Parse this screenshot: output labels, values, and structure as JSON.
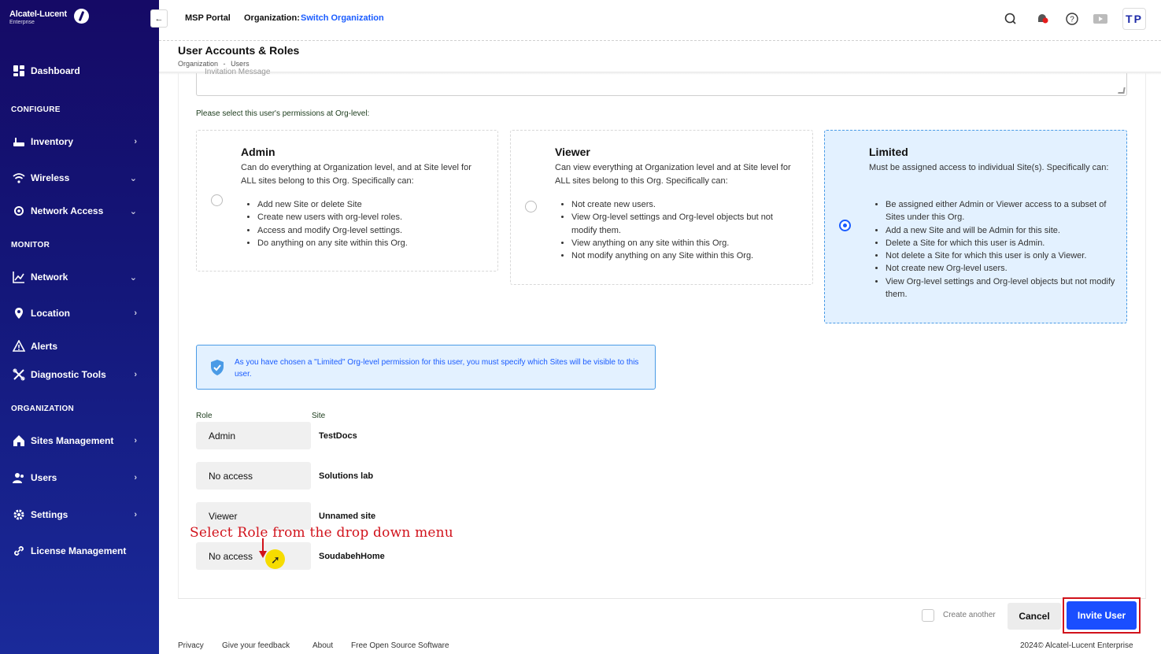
{
  "brand": {
    "name": "Alcatel-Lucent",
    "sub": "Enterprise"
  },
  "sidebar": {
    "dashboard": "Dashboard",
    "sections": {
      "configure": "CONFIGURE",
      "monitor": "MONITOR",
      "organization": "ORGANIZATION"
    },
    "items": {
      "inventory": "Inventory",
      "wireless": "Wireless",
      "network_access": "Network Access",
      "network": "Network",
      "location": "Location",
      "alerts": "Alerts",
      "diagnostic_tools": "Diagnostic Tools",
      "sites_management": "Sites Management",
      "users": "Users",
      "settings": "Settings",
      "license_management": "License Management"
    }
  },
  "topbar": {
    "portal": "MSP Portal",
    "org_label": "Organization:",
    "org_link": "Switch Organization",
    "avatar": "TP",
    "icons": [
      "search-icon",
      "notification-bell-icon",
      "help-icon",
      "video-icon"
    ],
    "accent": "#1a5cff"
  },
  "page": {
    "title": "User Accounts & Roles",
    "breadcrumb": [
      "Organization",
      "-",
      "Users"
    ]
  },
  "form": {
    "message_placeholder": "Invitation Message",
    "permissions_prompt": "Please select this user's permissions at Org-level:",
    "options": {
      "admin": {
        "title": "Admin",
        "desc": "Can do everything at Organization level, and at Site level for ALL sites belong to this Org. Specifically can:",
        "bullets": [
          "Add new Site or delete Site",
          "Create new users with org-level roles.",
          "Access and modify Org-level settings.",
          "Do anything on any site within this Org."
        ],
        "selected": false
      },
      "viewer": {
        "title": "Viewer",
        "desc": "Can view everything at Organization level and at Site level for ALL sites belong to this Org. Specifically can:",
        "bullets": [
          "Not create new users.",
          "View Org-level settings and Org-level objects but not modify them.",
          "View anything on any site within this Org.",
          "Not modify anything on any Site within this Org."
        ],
        "selected": false
      },
      "limited": {
        "title": "Limited",
        "desc": "Must be assigned access to individual Site(s). Specifically can:",
        "bullets": [
          "Be assigned either Admin or Viewer access to a subset of Sites under this Org.",
          "Add a new Site and will be Admin for this site.",
          "Delete a Site for which this user is Admin.",
          "Not delete a Site for which this user is only a Viewer.",
          "Not create new Org-level users.",
          "View Org-level settings and Org-level objects but not modify them."
        ],
        "selected": true
      }
    },
    "info_message": "As you have chosen a \"Limited\" Org-level permission for this user, you must specify which Sites will be visible to this user.",
    "columns": {
      "role": "Role",
      "site": "Site"
    },
    "rows": [
      {
        "role": "Admin",
        "site": "TestDocs"
      },
      {
        "role": "No access",
        "site": "Solutions lab"
      },
      {
        "role": "Viewer",
        "site": "Unnamed site"
      },
      {
        "role": "No access",
        "site": "SoudabehHome"
      }
    ],
    "annotation": "Select Role from the drop down menu",
    "create_another": "Create another",
    "cancel": "Cancel",
    "invite": "Invite User"
  },
  "footer": {
    "links": [
      "Privacy",
      "Give your feedback",
      "About",
      "Free Open Source Software"
    ],
    "copyright": "2024© Alcatel-Lucent Enterprise"
  }
}
